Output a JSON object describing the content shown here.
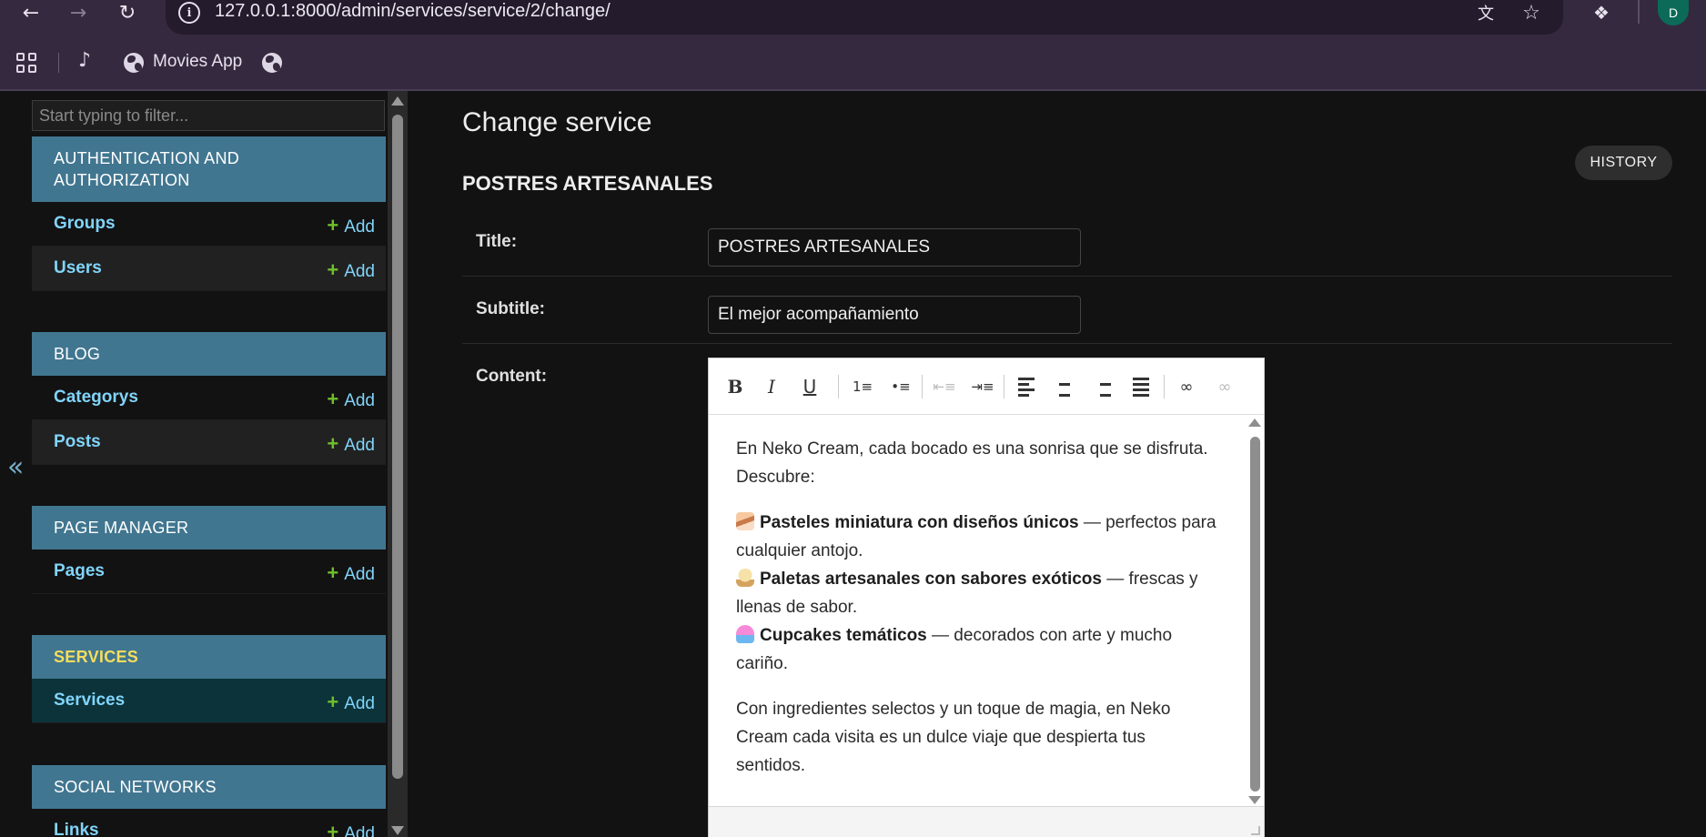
{
  "browser": {
    "url": "127.0.0.1:8000/admin/services/service/2/change/",
    "profile_initial": "D",
    "bookmarks": [
      {
        "label": "Movies App"
      }
    ]
  },
  "sidebar": {
    "filter_placeholder": "Start typing to filter...",
    "collapse_glyph": "«",
    "modules": [
      {
        "caption": "AUTHENTICATION AND AUTHORIZATION",
        "models": [
          {
            "name": "Groups",
            "add": "Add"
          },
          {
            "name": "Users",
            "add": "Add"
          }
        ]
      },
      {
        "caption": "BLOG",
        "models": [
          {
            "name": "Categorys",
            "add": "Add"
          },
          {
            "name": "Posts",
            "add": "Add"
          }
        ]
      },
      {
        "caption": "PAGE MANAGER",
        "models": [
          {
            "name": "Pages",
            "add": "Add"
          }
        ]
      },
      {
        "caption": "SERVICES",
        "current": true,
        "models": [
          {
            "name": "Services",
            "add": "Add"
          }
        ]
      },
      {
        "caption": "SOCIAL NETWORKS",
        "models": [
          {
            "name": "Links",
            "add": "Add"
          }
        ]
      }
    ]
  },
  "main": {
    "page_title": "Change service",
    "history_label": "HISTORY",
    "object_title": "POSTRES ARTESANALES",
    "fields": {
      "title_label": "Title:",
      "title_value": "POSTRES ARTESANALES",
      "subtitle_label": "Subtitle:",
      "subtitle_value": "El mejor acompañamiento",
      "content_label": "Content:"
    },
    "content": {
      "intro": "En Neko Cream, cada bocado es una sonrisa que se disfruta. Descubre:",
      "items": [
        {
          "bold": "Pasteles miniatura con diseños únicos",
          "rest": " — perfectos para cualquier antojo."
        },
        {
          "bold": "Paletas artesanales con sabores exóticos",
          "rest": " — frescas y llenas de sabor."
        },
        {
          "bold": "Cupcakes temáticos",
          "rest": " — decorados con arte y mucho cariño."
        }
      ],
      "outro": "Con ingredientes selectos y un toque de magia, en Neko Cream cada visita es un dulce viaje que despierta tus sentidos."
    }
  },
  "colors": {
    "module_header": "#417690",
    "link": "#81d4fa",
    "add_plus": "#70bf2b",
    "current_caption": "#f5dd5d",
    "browser_chrome": "#35293f"
  }
}
